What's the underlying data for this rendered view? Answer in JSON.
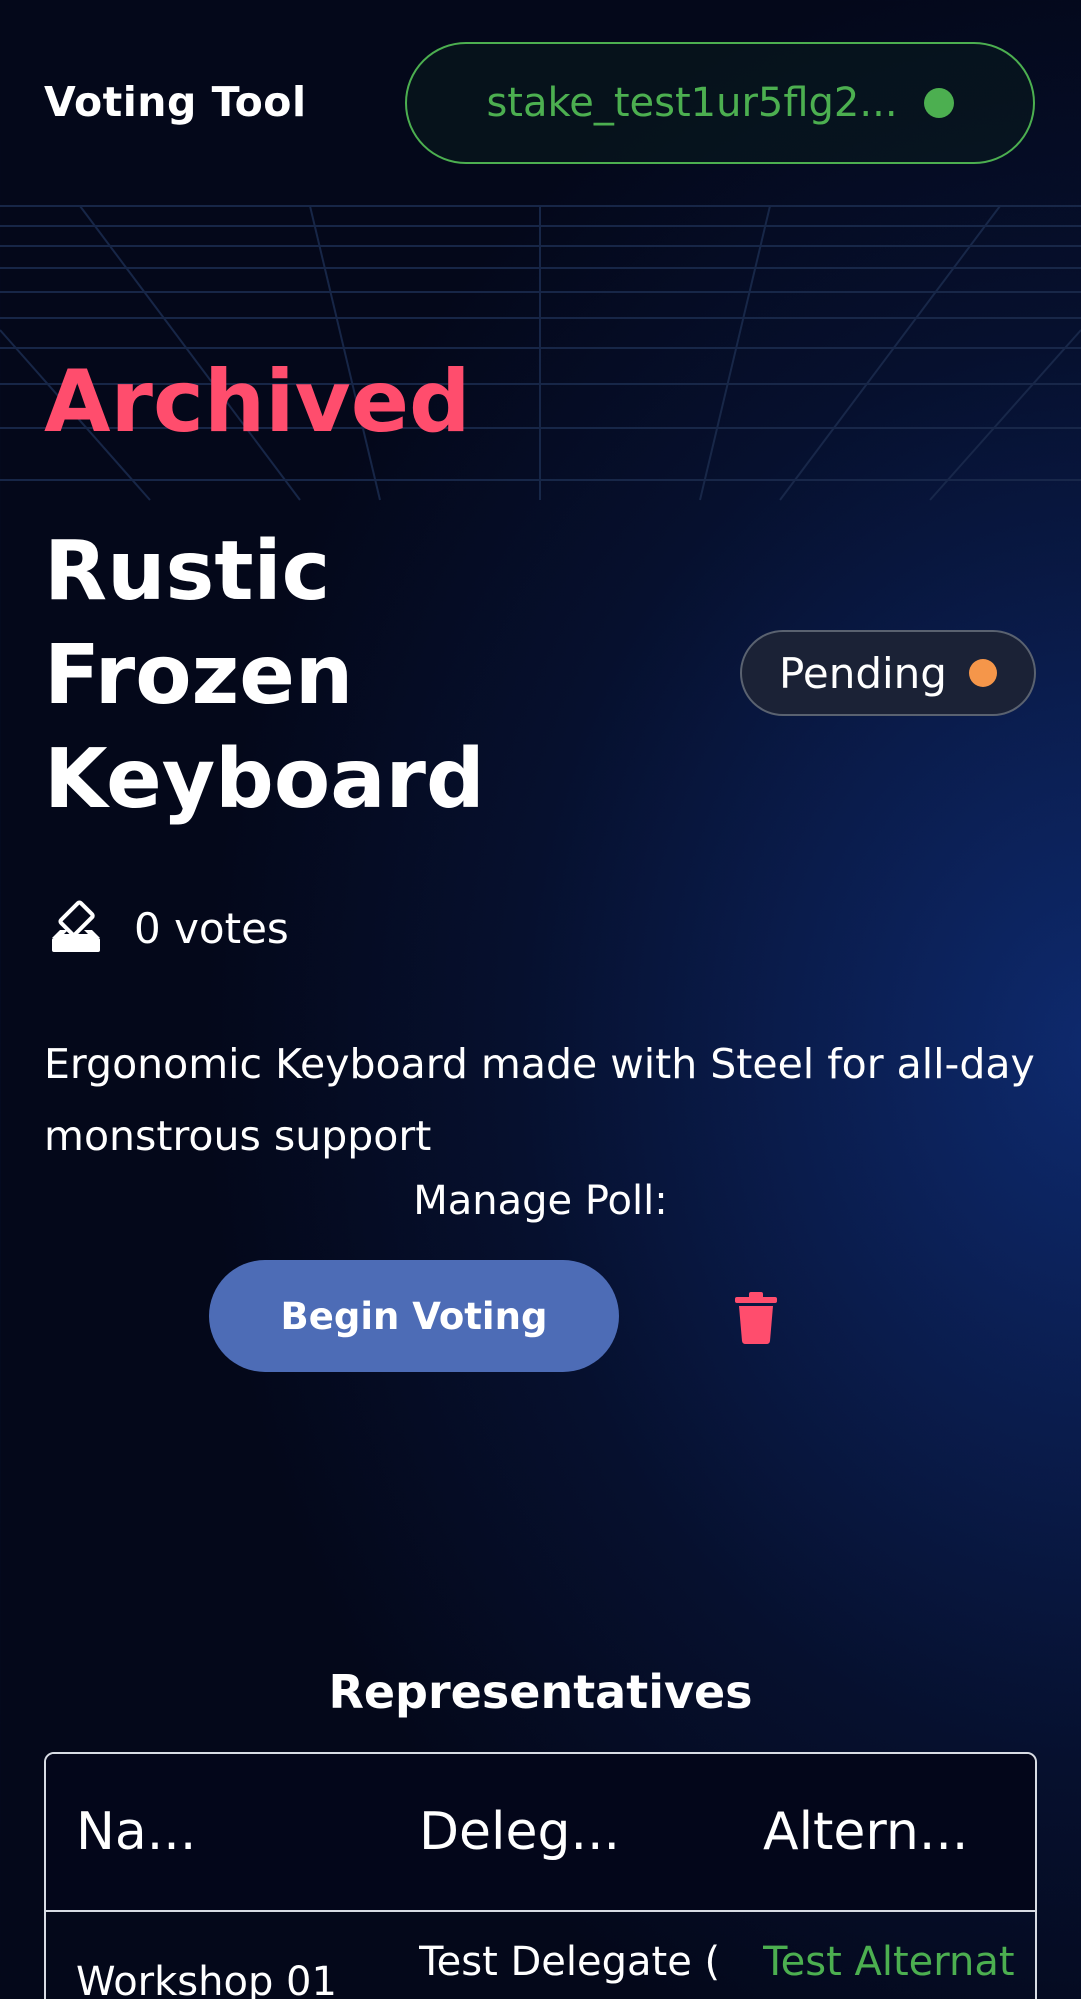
{
  "header": {
    "app_title": "Voting Tool",
    "wallet_address": "stake_test1ur5flg2...",
    "wallet_status_color": "#4caf50"
  },
  "poll": {
    "archive_label": "Archived",
    "title": "Rustic Frozen Keyboard",
    "status": "Pending",
    "status_color": "#f5964a",
    "votes_label": "0 votes",
    "description": "Ergonomic Keyboard made with Steel for all-day monstrous support",
    "manage_label": "Manage Poll:",
    "begin_button_label": "Begin Voting",
    "delete_icon": "trash-icon",
    "votes_icon": "ballot-box-icon"
  },
  "representatives": {
    "heading": "Representatives",
    "columns": [
      "Na...",
      "Deleg...",
      "Altern..."
    ],
    "rows": [
      {
        "name": "Workshop 01",
        "delegate": "Test Delegate (",
        "delegate_suffix": "[]",
        "alternate": "Test Alternat",
        "alternate_suffix": "[]"
      }
    ]
  },
  "colors": {
    "accent_red": "#ff4d6d",
    "accent_green": "#4caf50",
    "button_blue": "#4d6cb6"
  }
}
